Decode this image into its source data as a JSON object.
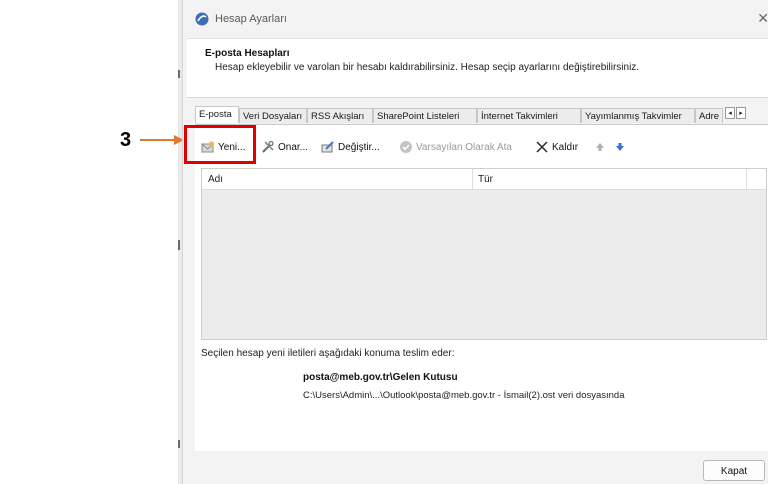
{
  "annotation": {
    "number": "3"
  },
  "window": {
    "title": "Hesap Ayarları",
    "close_symbol": "✕"
  },
  "header": {
    "title": "E-posta Hesapları",
    "description": "Hesap ekleyebilir ve varolan bir hesabı kaldırabilirsiniz. Hesap seçip ayarlarını değiştirebilirsiniz."
  },
  "tabs": [
    "E-posta",
    "Veri Dosyaları",
    "RSS Akışları",
    "SharePoint Listeleri",
    "İnternet Takvimleri",
    "Yayımlanmış Takvimler",
    "Adre"
  ],
  "tab_scroll": {
    "left": "◂",
    "right": "▸"
  },
  "toolbar": {
    "new": "Yeni...",
    "repair": "Onar...",
    "change": "Değiştir...",
    "set_default": "Varsayılan Olarak Ata",
    "remove": "Kaldır"
  },
  "list": {
    "columns": [
      "Adı",
      "Tür"
    ]
  },
  "delivery": {
    "label": "Seçilen hesap yeni iletileri aşağıdaki konuma teslim eder:",
    "mailbox": "posta@meb.gov.tr\\Gelen Kutusu",
    "path": "C:\\Users\\Admin\\...\\Outlook\\posta@meb.gov.tr - İsmail(2).ost veri dosyasında"
  },
  "footer": {
    "close": "Kapat"
  },
  "colors": {
    "highlight": "#e00000",
    "arrow": "#e07a2e"
  }
}
